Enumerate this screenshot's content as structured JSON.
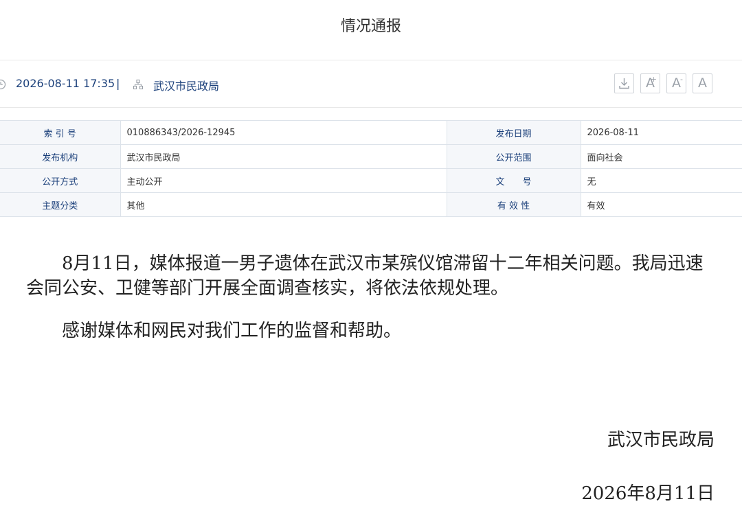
{
  "page": {
    "title": "情况通报"
  },
  "meta": {
    "datetime": "2026-08-11 17:35",
    "separator": "|",
    "publisher": "武汉市民政局",
    "tools": {
      "font_plus": "A",
      "font_plus_sup": "+",
      "font_minus": "A",
      "font_minus_sup": "-",
      "font_default": "A"
    }
  },
  "info_table": {
    "rows": [
      {
        "k1": "索 引 号",
        "v1": "010886343/2026-12945",
        "k2": "发布日期",
        "v2": "2026-08-11"
      },
      {
        "k1": "发布机构",
        "v1": "武汉市民政局",
        "k2": "公开范围",
        "v2": "面向社会"
      },
      {
        "k1": "公开方式",
        "v1": "主动公开",
        "k2": "文　　号",
        "v2": "无"
      },
      {
        "k1": "主题分类",
        "v1": "其他",
        "k2": "有 效 性",
        "v2": "有效"
      }
    ]
  },
  "content": {
    "paragraphs": [
      "8月11日，媒体报道一男子遗体在武汉市某殡仪馆滞留十二年相关问题。我局迅速会同公安、卫健等部门开展全面调查核实，将依法依规处理。",
      "感谢媒体和网民对我们工作的监督和帮助。"
    ],
    "signature_org": "武汉市民政局",
    "signature_date": "2026年8月11日"
  },
  "icons": [
    "clock-icon",
    "org-icon",
    "download-icon"
  ],
  "colors": {
    "link_blue": "#1a3f7a",
    "table_key_bg": "#f5f7fa",
    "border": "#dde3ea"
  }
}
